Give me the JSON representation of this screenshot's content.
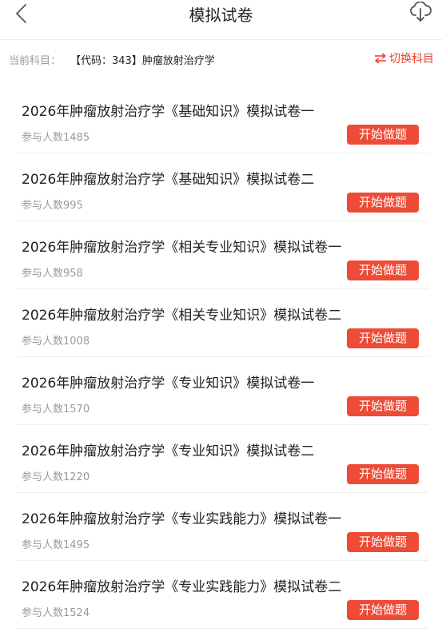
{
  "header": {
    "title": "模拟试卷",
    "back_icon": "chevron-left-icon",
    "download_icon": "cloud-download-icon"
  },
  "subject": {
    "label": "当前科目：",
    "value": "【代码：343】肿瘤放射治疗学",
    "switch_label": "切换科目",
    "switch_icon": "swap-icon"
  },
  "colors": {
    "accent": "#ee4b36",
    "muted_text": "#9a9a9a",
    "text": "#222222"
  },
  "exams": [
    {
      "title": "2026年肿瘤放射治疗学《基础知识》模拟试卷一",
      "count": "参与人数1485",
      "button": "开始做题"
    },
    {
      "title": "2026年肿瘤放射治疗学《基础知识》模拟试卷二",
      "count": "参与人数995",
      "button": "开始做题"
    },
    {
      "title": "2026年肿瘤放射治疗学《相关专业知识》模拟试卷一",
      "count": "参与人数958",
      "button": "开始做题"
    },
    {
      "title": "2026年肿瘤放射治疗学《相关专业知识》模拟试卷二",
      "count": "参与人数1008",
      "button": "开始做题"
    },
    {
      "title": "2026年肿瘤放射治疗学《专业知识》模拟试卷一",
      "count": "参与人数1570",
      "button": "开始做题"
    },
    {
      "title": "2026年肿瘤放射治疗学《专业知识》模拟试卷二",
      "count": "参与人数1220",
      "button": "开始做题"
    },
    {
      "title": "2026年肿瘤放射治疗学《专业实践能力》模拟试卷一",
      "count": "参与人数1495",
      "button": "开始做题"
    },
    {
      "title": "2026年肿瘤放射治疗学《专业实践能力》模拟试卷二",
      "count": "参与人数1524",
      "button": "开始做题"
    }
  ]
}
